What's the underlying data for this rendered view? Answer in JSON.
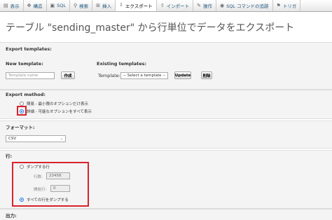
{
  "tabs": [
    {
      "label": "表示",
      "icon": "▤"
    },
    {
      "label": "構造",
      "icon": "✥"
    },
    {
      "label": "SQL",
      "icon": "▣"
    },
    {
      "label": "検索",
      "icon": "⚲"
    },
    {
      "label": "挿入",
      "icon": "⊞"
    },
    {
      "label": "エクスポート",
      "icon": "⇩"
    },
    {
      "label": "インポート",
      "icon": "⇧"
    },
    {
      "label": "操作",
      "icon": "✎"
    },
    {
      "label": "SQL コマンドの追跡",
      "icon": "◉"
    },
    {
      "label": "トリガ",
      "icon": "⚑"
    }
  ],
  "page_title": "テーブル \"sending_master\" から行単位でデータをエクスポート",
  "export_templates": {
    "legend": "Export templates:",
    "new_heading": "New template:",
    "name_placeholder": "Template name",
    "create_button": "作成",
    "existing_heading": "Existing templates:",
    "template_label": "Template:",
    "template_select": "-- Select a template --",
    "update_button": "Update",
    "delete_button": "削除"
  },
  "export_method": {
    "legend": "Export method:",
    "options": [
      "簡易 - 最小限のオプションだけ表示",
      "詳細 - 可能なオプションをすべて表示"
    ],
    "selected_index": 1
  },
  "format": {
    "legend": "フォーマット:",
    "value": "CSV"
  },
  "rows": {
    "legend": "行:",
    "dump_some_label": "ダンプする行",
    "row_count_label": "行数:",
    "row_count_value": "23458",
    "start_row_label": "開始行:",
    "start_row_value": "0",
    "dump_all_label": "すべての行をダンプする",
    "selected": "dump_all"
  },
  "output": {
    "legend": "出力:"
  },
  "colors": {
    "highlight": "#d9232a",
    "radio_selected": "#1a73e8"
  }
}
